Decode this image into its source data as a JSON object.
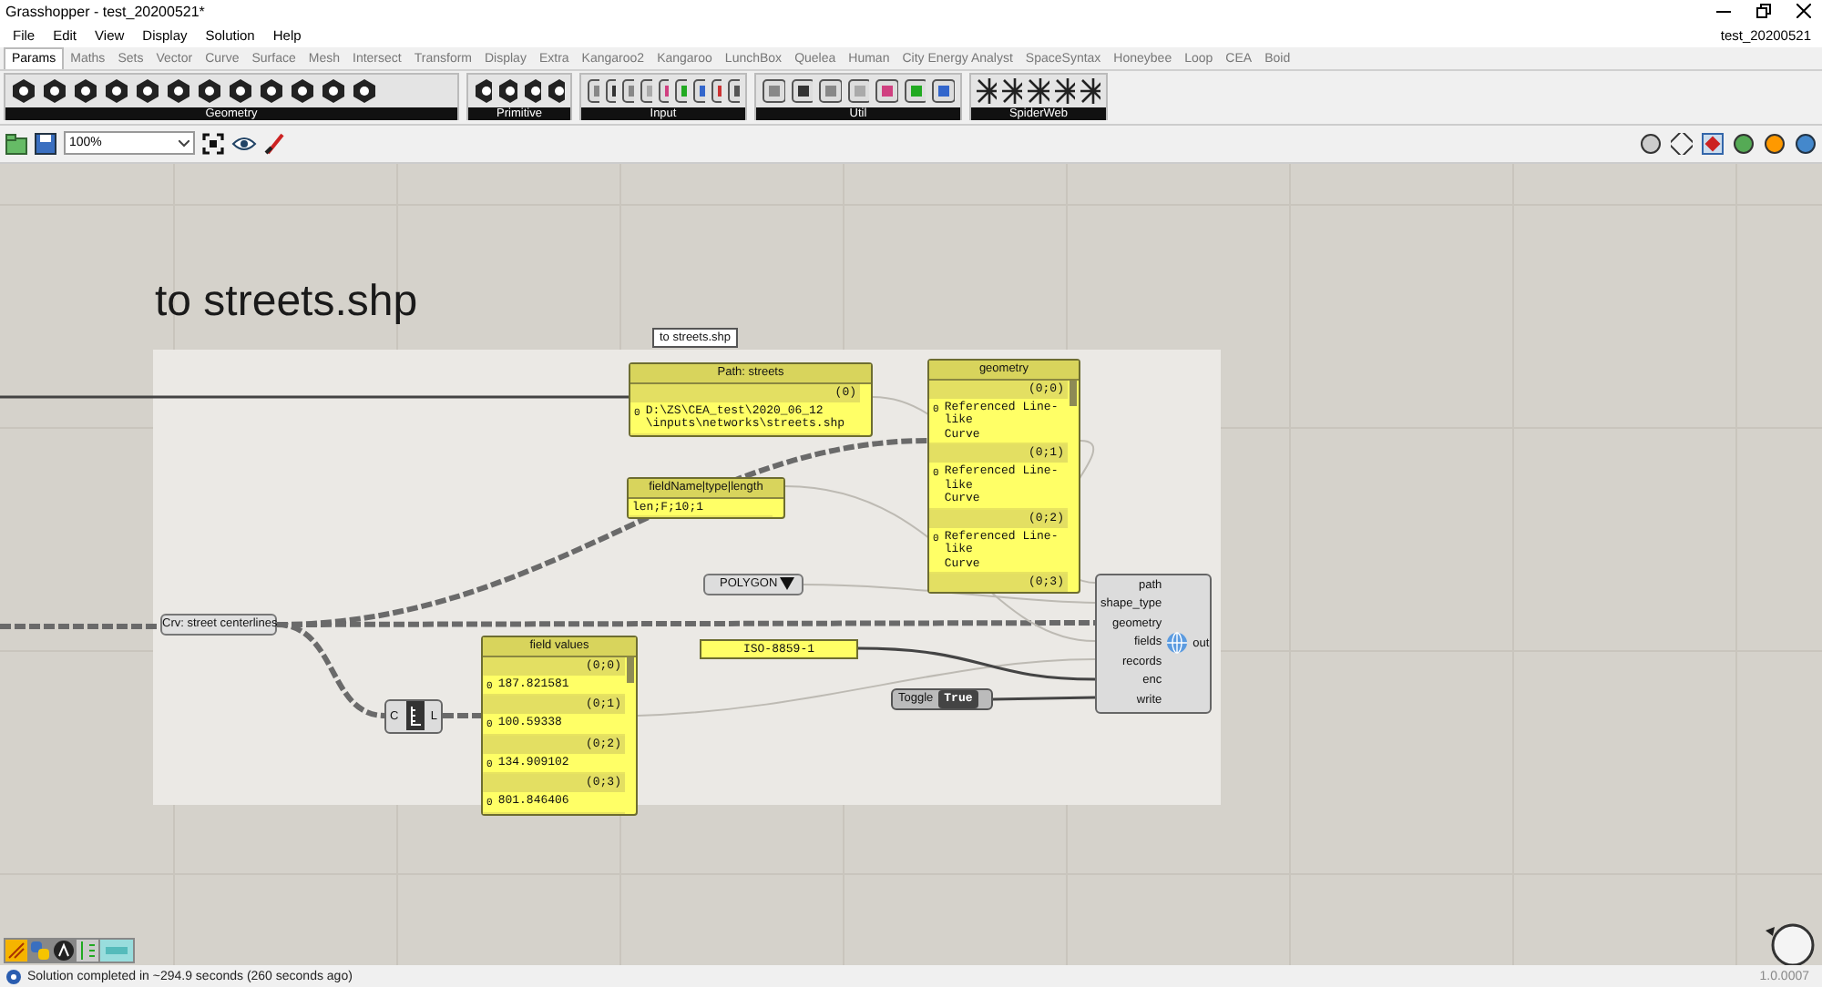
{
  "window": {
    "title": "Grasshopper - test_20200521*",
    "document": "test_20200521"
  },
  "menu": [
    "File",
    "Edit",
    "View",
    "Display",
    "Solution",
    "Help"
  ],
  "tabs": [
    {
      "label": "Params",
      "selected": true
    },
    {
      "label": "Maths",
      "selected": false
    },
    {
      "label": "Sets",
      "selected": false
    },
    {
      "label": "Vector",
      "selected": false
    },
    {
      "label": "Curve",
      "selected": false
    },
    {
      "label": "Surface",
      "selected": false
    },
    {
      "label": "Mesh",
      "selected": false
    },
    {
      "label": "Intersect",
      "selected": false
    },
    {
      "label": "Transform",
      "selected": false
    },
    {
      "label": "Display",
      "selected": false
    },
    {
      "label": "Extra",
      "selected": false
    },
    {
      "label": "Kangaroo2",
      "selected": false
    },
    {
      "label": "Kangaroo",
      "selected": false
    },
    {
      "label": "LunchBox",
      "selected": false
    },
    {
      "label": "Quelea",
      "selected": false
    },
    {
      "label": "Human",
      "selected": false
    },
    {
      "label": "City Energy Analyst",
      "selected": false
    },
    {
      "label": "SpaceSyntax",
      "selected": false
    },
    {
      "label": "Honeybee",
      "selected": false
    },
    {
      "label": "Loop",
      "selected": false
    },
    {
      "label": "CEA",
      "selected": false
    },
    {
      "label": "Boid",
      "selected": false
    }
  ],
  "ribbon_groups": [
    "Geometry",
    "Primitive",
    "Input",
    "Util",
    "SpiderWeb"
  ],
  "toolbar": {
    "zoom": "100%"
  },
  "canvas": {
    "heading": "to streets.shp",
    "group_label": "to streets.shp",
    "nodes": [
      {
        "kind": "panel",
        "title": "Path: streets",
        "branches": [
          {
            "path": "(0)",
            "items": [
              {
                "index": "0",
                "lines": [
                  "D:\\ZS\\CEA_test\\2020_06_12",
                  "\\inputs\\networks\\streets.shp"
                ]
              }
            ]
          }
        ]
      },
      {
        "kind": "panel",
        "title": "geometry",
        "branches": [
          {
            "path": "(0;0)",
            "items": [
              {
                "index": "0",
                "lines": [
                  "Referenced Line-like",
                  "Curve"
                ]
              }
            ]
          },
          {
            "path": "(0;1)",
            "items": [
              {
                "index": "0",
                "lines": [
                  "Referenced Line-like",
                  "Curve"
                ]
              }
            ]
          },
          {
            "path": "(0;2)",
            "items": [
              {
                "index": "0",
                "lines": [
                  "Referenced Line-like",
                  "Curve"
                ]
              }
            ]
          },
          {
            "path": "(0;3)"
          }
        ]
      },
      {
        "kind": "panel",
        "title": "fieldName|type|length",
        "branches": [
          {
            "items": [
              {
                "lines": [
                  "len;F;10;1"
                ]
              }
            ]
          }
        ]
      },
      {
        "kind": "panel",
        "title": "field values",
        "branches": [
          {
            "path": "(0;0)",
            "items": [
              {
                "index": "0",
                "lines": [
                  "187.821581"
                ]
              }
            ]
          },
          {
            "path": "(0;1)",
            "items": [
              {
                "index": "0",
                "lines": [
                  "100.59338"
                ]
              }
            ]
          },
          {
            "path": "(0;2)",
            "items": [
              {
                "index": "0",
                "lines": [
                  "134.909102"
                ]
              }
            ]
          },
          {
            "path": "(0;3)",
            "items": [
              {
                "index": "0",
                "lines": [
                  "801.846406"
                ]
              }
            ]
          }
        ]
      },
      {
        "kind": "param",
        "label": "Crv: street centerlines"
      },
      {
        "kind": "value_list",
        "value": "POLYGON"
      },
      {
        "kind": "text_panel",
        "value": "ISO-8859-1"
      },
      {
        "kind": "component",
        "inputs": [
          "C"
        ],
        "outputs": [
          "L"
        ]
      },
      {
        "kind": "toggle",
        "label": "Toggle",
        "value": "True"
      },
      {
        "kind": "component",
        "inputs": [
          "path",
          "shape_type",
          "geometry",
          "fields",
          "records",
          "enc",
          "write"
        ],
        "outputs": [
          "out"
        ]
      }
    ]
  },
  "status": {
    "message": "Solution completed in ~294.9 seconds (260 seconds ago)",
    "version": "1.0.0007"
  }
}
